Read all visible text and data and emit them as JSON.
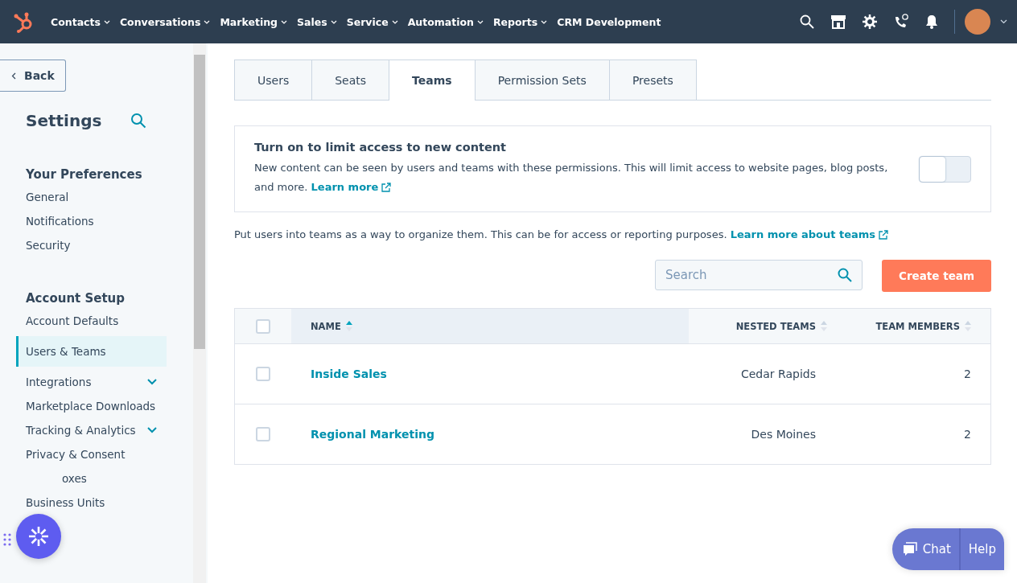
{
  "top_nav": {
    "menus": [
      {
        "label": "Contacts",
        "dropdown": true
      },
      {
        "label": "Conversations",
        "dropdown": true
      },
      {
        "label": "Marketing",
        "dropdown": true
      },
      {
        "label": "Sales",
        "dropdown": true
      },
      {
        "label": "Service",
        "dropdown": true
      },
      {
        "label": "Automation",
        "dropdown": true
      },
      {
        "label": "Reports",
        "dropdown": true
      },
      {
        "label": "CRM Development",
        "dropdown": false
      }
    ]
  },
  "sidebar": {
    "back": "Back",
    "title": "Settings",
    "sections": [
      {
        "heading": "Your Preferences",
        "items": [
          {
            "label": "General",
            "selected": false,
            "kind": "link"
          },
          {
            "label": "Notifications",
            "selected": false,
            "kind": "link"
          },
          {
            "label": "Security",
            "selected": false,
            "kind": "link"
          }
        ]
      },
      {
        "heading": "Account Setup",
        "items": [
          {
            "label": "Account Defaults",
            "selected": false,
            "kind": "link"
          },
          {
            "label": "Users & Teams",
            "selected": true,
            "kind": "link"
          },
          {
            "label": "Integrations",
            "selected": false,
            "kind": "group",
            "expanded": false
          },
          {
            "label": "Marketplace Downloads",
            "selected": false,
            "kind": "link"
          },
          {
            "label": "Tracking & Analytics",
            "selected": false,
            "kind": "group",
            "expanded": false
          },
          {
            "label": "Privacy & Consent",
            "selected": false,
            "kind": "link"
          },
          {
            "label": "oxes",
            "selected": false,
            "kind": "covered"
          },
          {
            "label": "Business Units",
            "selected": false,
            "kind": "link"
          }
        ]
      }
    ]
  },
  "tabs": [
    {
      "label": "Users",
      "selected": false
    },
    {
      "label": "Seats",
      "selected": false
    },
    {
      "label": "Teams",
      "selected": true
    },
    {
      "label": "Permission Sets",
      "selected": false
    },
    {
      "label": "Presets",
      "selected": false
    }
  ],
  "limit_card": {
    "title": "Turn on to limit access to new content",
    "text": "New content can be seen by users and teams with these permissions. This will limit access to website pages, blog posts, and more.",
    "link": "Learn more",
    "on": false
  },
  "intro": {
    "text": "Put users into teams as a way to organize them. This can be for access or reporting purposes.",
    "link": "Learn more about teams"
  },
  "search": {
    "placeholder": "Search"
  },
  "create_button": "Create team",
  "table": {
    "all_checked": false,
    "columns": [
      {
        "label": "NAME",
        "sorted": true
      },
      {
        "label": "NESTED TEAMS",
        "sorted": false
      },
      {
        "label": "TEAM MEMBERS",
        "sorted": false
      }
    ],
    "rows": [
      {
        "checked": false,
        "name": "Inside Sales",
        "nested": "Cedar Rapids",
        "members": "2"
      },
      {
        "checked": false,
        "name": "Regional Marketing",
        "nested": "Des Moines",
        "members": "2"
      }
    ]
  },
  "chat": {
    "chat": "Chat",
    "help": "Help"
  }
}
